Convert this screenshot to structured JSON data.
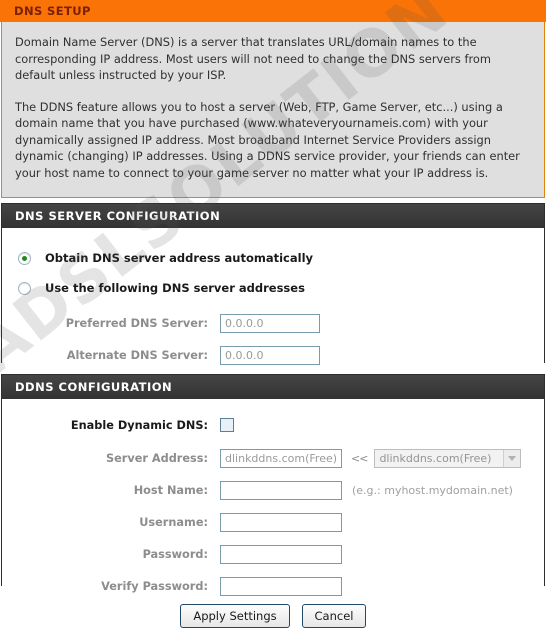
{
  "intro": {
    "title": "DNS SETUP",
    "paragraphs": [
      "Domain Name Server (DNS) is a server that translates URL/domain names to the corresponding IP address. Most users will not need to change the DNS servers from default unless instructed by your ISP.",
      "The DDNS feature allows you to host a server (Web, FTP, Game Server, etc...) using a domain name that you have purchased (www.whateveryournameis.com) with your dynamically assigned IP address. Most broadband Internet Service Providers assign dynamic (changing) IP addresses. Using a DDNS service provider, your friends can enter your host name to connect to your game server no matter what your IP address is."
    ]
  },
  "dns_server": {
    "title": "DNS SERVER CONFIGURATION",
    "radio_auto_label": "Obtain DNS server address automatically",
    "radio_manual_label": "Use the following DNS server addresses",
    "preferred_label": "Preferred DNS Server:",
    "preferred_value": "0.0.0.0",
    "alternate_label": "Alternate DNS Server:",
    "alternate_value": "0.0.0.0"
  },
  "ddns": {
    "title": "DDNS CONFIGURATION",
    "enable_label": "Enable Dynamic DNS:",
    "server_address_label": "Server Address:",
    "server_address_value": "dlinkddns.com(Free)",
    "arrows": "<<",
    "server_select_value": "dlinkddns.com(Free)",
    "host_name_label": "Host Name:",
    "host_name_value": "",
    "host_name_hint": "(e.g.: myhost.mydomain.net)",
    "username_label": "Username:",
    "username_value": "",
    "password_label": "Password:",
    "password_value": "",
    "verify_password_label": "Verify Password:",
    "verify_password_value": ""
  },
  "footer": {
    "apply_label": "Apply Settings",
    "cancel_label": "Cancel"
  },
  "watermark": {
    "text": "ADSLSOLUTION"
  },
  "colors": {
    "header_orange": "#f97306",
    "header_orange_text": "#7d1f00",
    "section_header_bg": "#3a3a3a",
    "intro_bg": "#dfdfdf",
    "radio_dot_green": "#1d8a1d"
  }
}
